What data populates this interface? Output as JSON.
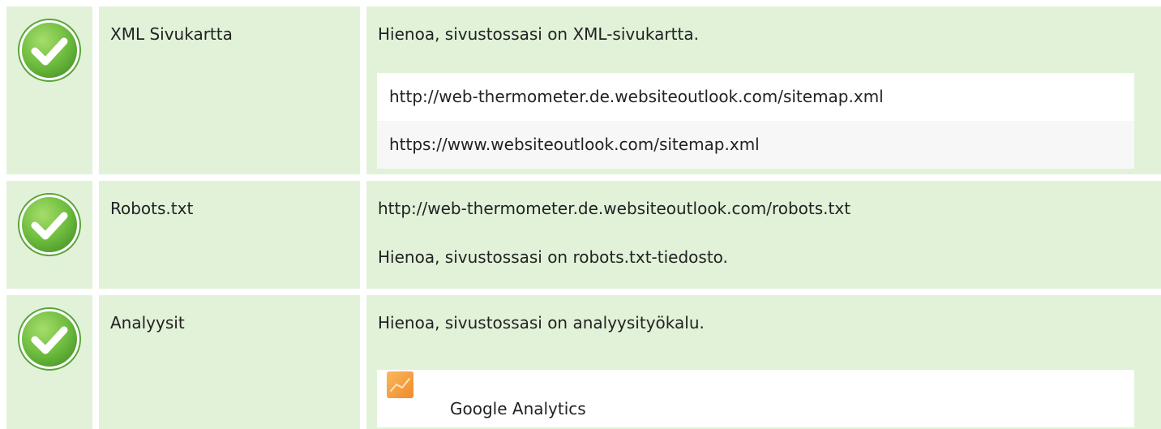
{
  "rows": [
    {
      "icon": "check-circle-icon",
      "label": "XML Sivukartta",
      "message": "Hienoa, sivustossasi on XML-sivukartta.",
      "urls": [
        "http://web-thermometer.de.websiteoutlook.com/sitemap.xml",
        "https://www.websiteoutlook.com/sitemap.xml"
      ]
    },
    {
      "icon": "check-circle-icon",
      "label": "Robots.txt",
      "url": "http://web-thermometer.de.websiteoutlook.com/robots.txt",
      "message": "Hienoa, sivustossasi on robots.txt-tiedosto."
    },
    {
      "icon": "check-circle-icon",
      "label": "Analyysit",
      "message": "Hienoa, sivustossasi on analyysityökalu.",
      "tool": {
        "icon": "google-analytics-icon",
        "name": "Google Analytics"
      }
    }
  ],
  "colors": {
    "row_background": "#e1f2d9",
    "check_green": "#6ebd3f",
    "analytics_orange": "#f5a742"
  }
}
